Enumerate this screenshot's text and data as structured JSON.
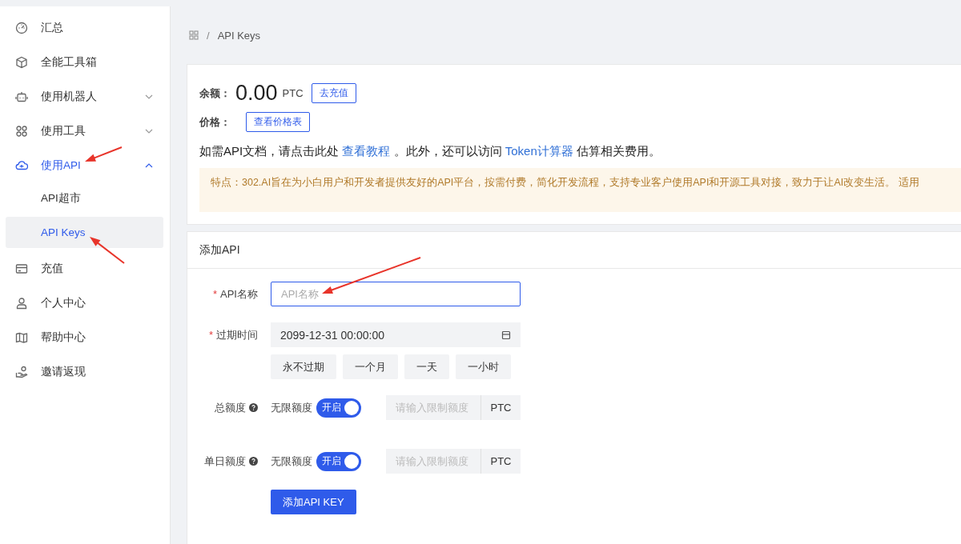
{
  "sidebar": {
    "items": [
      {
        "label": "汇总",
        "selected": false
      },
      {
        "label": "全能工具箱",
        "selected": false
      },
      {
        "label": "使用机器人",
        "selected": false,
        "expanded": false
      },
      {
        "label": "使用工具",
        "selected": false,
        "expanded": false
      },
      {
        "label": "使用API",
        "selected": true,
        "expanded": true,
        "children": [
          {
            "label": "API超市",
            "selected": false
          },
          {
            "label": "API Keys",
            "selected": true
          }
        ]
      },
      {
        "label": "充值",
        "selected": false
      },
      {
        "label": "个人中心",
        "selected": false
      },
      {
        "label": "帮助中心",
        "selected": false
      },
      {
        "label": "邀请返现",
        "selected": false
      }
    ]
  },
  "breadcrumb": {
    "separator": "/",
    "current": "API Keys"
  },
  "balance": {
    "label": "余额：",
    "amount": "0.00",
    "unit": "PTC",
    "button": "去充值"
  },
  "price": {
    "label": "价格：",
    "button": "查看价格表"
  },
  "doc_text": [
    {
      "kind": "text",
      "text": "如需API文档，请点击此处 "
    },
    {
      "kind": "link",
      "text": "查看教程"
    },
    {
      "kind": "text",
      "text": " 。此外，还可以访问 "
    },
    {
      "kind": "link",
      "text": "Token计算器"
    },
    {
      "kind": "text",
      "text": " 估算相关费用。"
    }
  ],
  "notice": "特点：302.AI旨在为小白用户和开发者提供友好的API平台，按需付费，简化开发流程，支持专业客户使用API和开源工具对接，致力于让AI改变生活。 适用",
  "form": {
    "title": "添加API",
    "fields": [
      {
        "kind": "text",
        "label": "API名称",
        "required": true,
        "required_mark": "*",
        "placeholder": "API名称"
      },
      {
        "kind": "date",
        "label": "过期时间",
        "required": true,
        "required_mark": "*",
        "value": "2099-12-31 00:00:00",
        "presets": [
          "永不过期",
          "一个月",
          "一天",
          "一小时"
        ]
      }
    ],
    "quotas": [
      {
        "label": "总额度",
        "toggle_label": "无限额度",
        "switch_text": "开启",
        "on": true,
        "placeholder": "请输入限制额度",
        "unit": "PTC"
      },
      {
        "label": "单日额度",
        "toggle_label": "无限额度",
        "switch_text": "开启",
        "on": true,
        "placeholder": "请输入限制额度",
        "unit": "PTC"
      }
    ],
    "submit": "添加API KEY"
  }
}
